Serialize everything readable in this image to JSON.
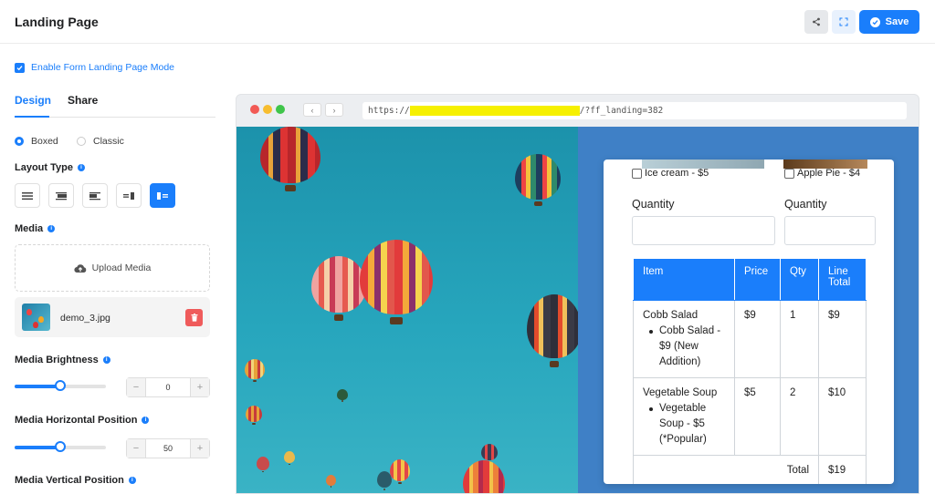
{
  "header": {
    "title": "Landing Page",
    "save_label": "Save"
  },
  "settings": {
    "enable_label": "Enable Form Landing Page Mode",
    "tabs": [
      {
        "label": "Design"
      },
      {
        "label": "Share"
      }
    ],
    "style_options": [
      {
        "label": "Boxed",
        "selected": true
      },
      {
        "label": "Classic",
        "selected": false
      }
    ],
    "layout_type_label": "Layout Type",
    "media_label": "Media",
    "upload_label": "Upload Media",
    "file_name": "demo_3.jpg",
    "brightness": {
      "label": "Media Brightness",
      "value": "0"
    },
    "horizontal": {
      "label": "Media Horizontal Position",
      "value": "50"
    },
    "vertical": {
      "label": "Media Vertical Position"
    }
  },
  "preview": {
    "url_prefix": "https://",
    "url_suffix": "/?ff_landing=382",
    "options": [
      "Ice cream - $5",
      "Apple Pie - $4"
    ],
    "quantity_label": "Quantity",
    "table": {
      "headers": [
        "Item",
        "Price",
        "Qty",
        "Line Total"
      ],
      "rows": [
        {
          "item": "Cobb Salad",
          "detail": "Cobb Salad - $9 (New Addition)",
          "price": "$9",
          "qty": "1",
          "total": "$9"
        },
        {
          "item": "Vegetable Soup",
          "detail": "Vegetable Soup - $5 (*Popular)",
          "price": "$5",
          "qty": "2",
          "total": "$10"
        }
      ],
      "total_label": "Total",
      "total_value": "$19"
    }
  },
  "colors": {
    "accent": "#1a7efb",
    "danger": "#ef5b5b",
    "url_highlight": "#f6f000"
  }
}
